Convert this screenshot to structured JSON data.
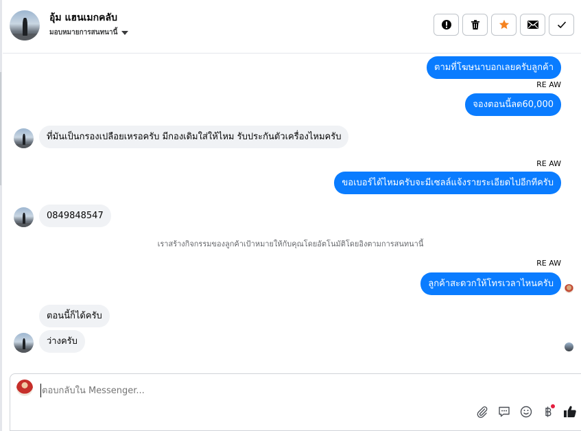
{
  "header": {
    "contact_name": "อุ้ม แฮนเมกคลับ",
    "assign_label": "มอบหมายการสนทนานี้",
    "actions": [
      "mark-spam",
      "delete",
      "star",
      "mark-unread",
      "mark-done"
    ]
  },
  "messages": {
    "m1": {
      "direction": "outgoing",
      "text": "ตามที่โฆษนาบอกเลยครับลูกค้า"
    },
    "m2_sender": "RE AW",
    "m2": {
      "direction": "outgoing",
      "text": "จองตอนนี้ลด60,000"
    },
    "m3": {
      "direction": "incoming",
      "text": "ที่มันเป็นกรองเปลือยเหรอครับ มีกองเดิมใส่ให้ไหม รับประกันตัวเครื่องไหมครับ"
    },
    "m4_sender": "RE AW",
    "m4": {
      "direction": "outgoing",
      "text": "ขอเบอร์ได้ไหมครับจะมีเซลล์แจ้งรายระเอียดไปอีกทีครับ"
    },
    "m5": {
      "direction": "incoming",
      "text": "0849848547"
    },
    "system_note": "เราสร้างกิจกรรมของลูกค้าเป้าหมายให้กับคุณโดยอัตโนมัติโดยอิงตามการสนทนานี้",
    "m6_sender": "RE AW",
    "m6": {
      "direction": "outgoing",
      "text": "ลูกค้าสะดวกให้โทรเวลาไหนครับ"
    },
    "m7": {
      "direction": "incoming",
      "text": "ตอนนี้ก็ได้ครับ"
    },
    "m8": {
      "direction": "incoming",
      "text": "ว่างครับ"
    }
  },
  "composer": {
    "placeholder": "ตอบกลับใน Messenger...",
    "tools": [
      "attach-icon",
      "saved-reply-icon",
      "emoji-icon",
      "payment-icon",
      "like-icon"
    ]
  },
  "colors": {
    "outgoing_bubble": "#0a7cff",
    "incoming_bubble": "#f0f2f5",
    "star": "#f5821f"
  }
}
